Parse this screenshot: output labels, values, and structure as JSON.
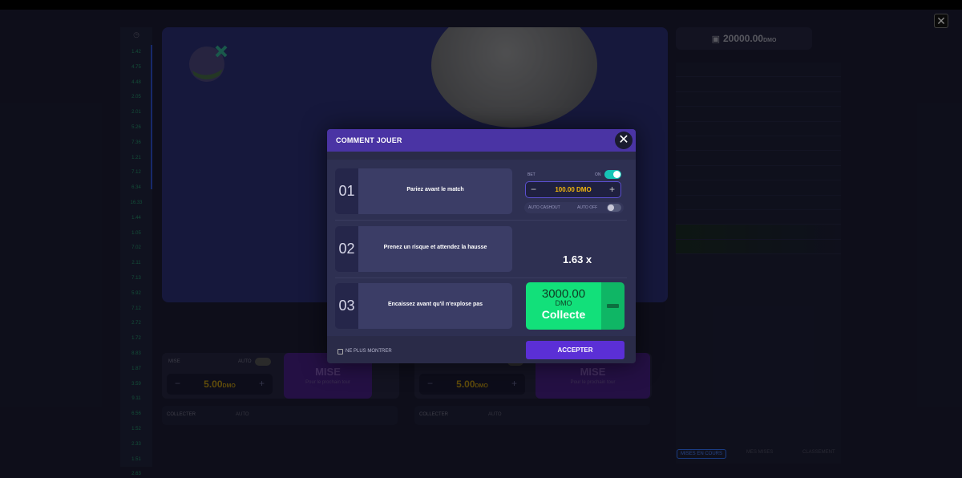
{
  "balance": {
    "amount": "20000.00",
    "unit": "DMO"
  },
  "left_multipliers": [
    "1.42",
    "4.75",
    "4.48",
    "2.05",
    "2.01",
    "5.26",
    "7.36",
    "1.21",
    "7.12",
    "6.34",
    "16.33",
    "1.44",
    "1.05",
    "7.02",
    "2.11",
    "7.13",
    "5.92",
    "7.12",
    "2.72",
    "1.72",
    "8.83",
    "1.87",
    "3.59",
    "9.11",
    "6.56",
    "1.52",
    "2.33",
    "1.51",
    "2.63"
  ],
  "bet_panels": [
    {
      "label": "MISE",
      "auto": "AUTO",
      "value": "5.00",
      "unit": "DMO",
      "mise_label": "MISE",
      "mise_sub": "Pour le prochain tour",
      "collect_label": "COLLECTER",
      "collect_auto": "AUTO"
    },
    {
      "label": "MISE",
      "auto": "AUTO",
      "value": "5.00",
      "unit": "DMO",
      "mise_label": "MISE",
      "mise_sub": "Pour le prochain tour",
      "collect_label": "COLLECTER",
      "collect_auto": "AUTO"
    }
  ],
  "right_tabs": {
    "tab1": "MISES EN COURS",
    "tab2": "MES MISES",
    "tab3": "CLASSEMENT"
  },
  "logo": {
    "text": "Cricket X"
  },
  "modal": {
    "title": "COMMENT JOUER",
    "steps": [
      {
        "num": "01",
        "text": "Pariez avant le match"
      },
      {
        "num": "02",
        "text": "Prenez un risque et attendez la hausse"
      },
      {
        "num": "03",
        "text": "Encaissez avant qu'il n'explose pas"
      }
    ],
    "demo_bet": {
      "bet_label": "BET",
      "on_label": "ON",
      "value": "100.00 DMO",
      "auto_cashout": "AUTO CASHOUT",
      "auto_off": "AUTO OFF"
    },
    "multiplier": "1.63 x",
    "collect": {
      "amount": "3000.00",
      "unit": "DMO",
      "label": "Collecte"
    },
    "dont_show": "NE PLUS MONTRER",
    "accept": "ACCEPTER"
  },
  "colors": {
    "accent": "#4a34a4",
    "collect": "#12e07a",
    "bet_value": "#f2b70d",
    "toggle_on": "#17c4b6"
  }
}
